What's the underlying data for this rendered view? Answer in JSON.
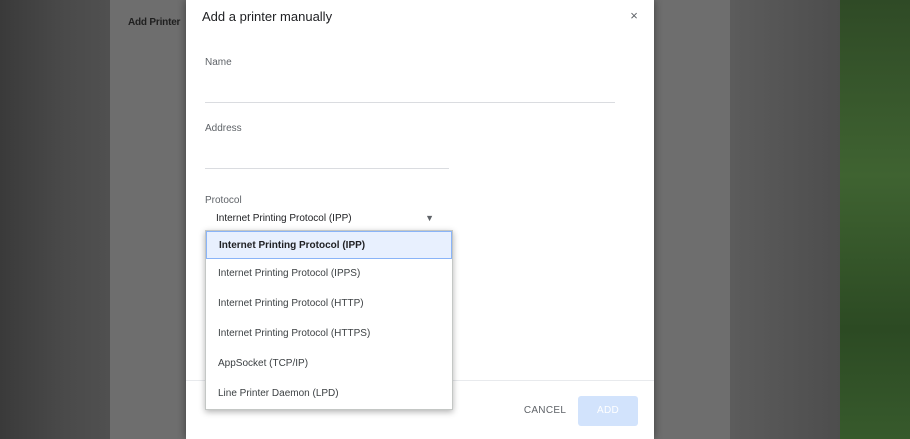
{
  "background": {
    "page_text": "Add Printer"
  },
  "dialog": {
    "title": "Add a printer manually",
    "close_glyph": "×",
    "name": {
      "label": "Name",
      "value": ""
    },
    "address": {
      "label": "Address",
      "value": ""
    },
    "protocol": {
      "label": "Protocol",
      "selected": "Internet Printing Protocol (IPP)",
      "arrow_glyph": "▼",
      "options": [
        "Internet Printing Protocol (IPP)",
        "Internet Printing Protocol (IPPS)",
        "Internet Printing Protocol (HTTP)",
        "Internet Printing Protocol (HTTPS)",
        "AppSocket (TCP/IP)",
        "Line Printer Daemon (LPD)"
      ]
    },
    "buttons": {
      "cancel": "CANCEL",
      "add": "ADD"
    }
  },
  "colors": {
    "accent_disabled": "#d2e3fc",
    "selected_option_bg": "#e8f0fe"
  }
}
